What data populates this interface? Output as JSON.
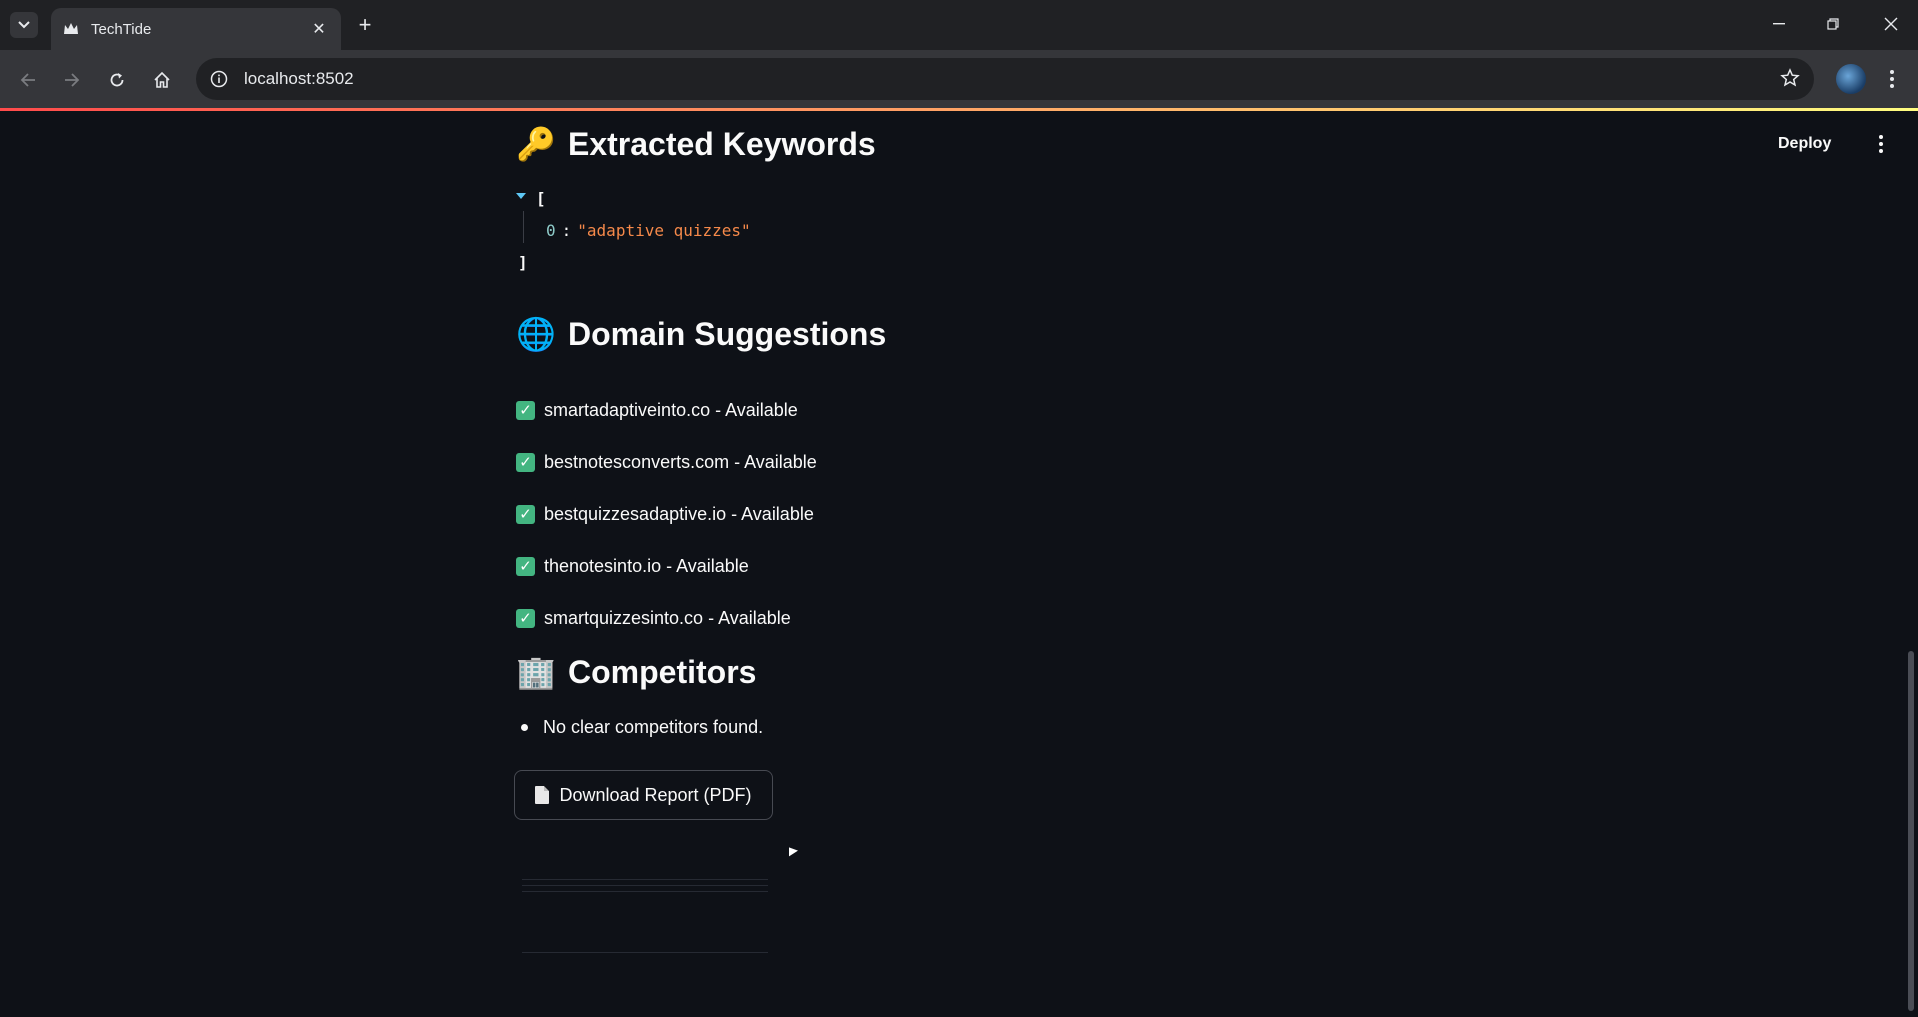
{
  "browser": {
    "tab_title": "TechTide",
    "url": "localhost:8502",
    "new_tab_symbol": "+",
    "close_symbol": "✕"
  },
  "app": {
    "deploy_label": "Deploy",
    "accent_colors": [
      "#ff4b4b",
      "#fffd80"
    ]
  },
  "keywords": {
    "emoji": "🔑",
    "heading": "Extracted Keywords",
    "open_bracket": "[",
    "close_bracket": "]",
    "items": [
      {
        "index": "0",
        "value": "\"adaptive quizzes\""
      }
    ]
  },
  "domains": {
    "emoji": "🌐",
    "heading": "Domain Suggestions",
    "check_symbol": "✓",
    "items": [
      "smartadaptiveinto.co - Available",
      "bestnotesconverts.com - Available",
      "bestquizzesadaptive.io - Available",
      "thenotesinto.io - Available",
      "smartquizzesinto.co - Available"
    ]
  },
  "competitors": {
    "emoji": "🏢",
    "heading": "Competitors",
    "items": [
      "No clear competitors found."
    ]
  },
  "download": {
    "label": "Download Report (PDF)"
  },
  "icons": {
    "tab_favicon": "crown-icon",
    "back": "arrow-left-icon",
    "forward": "arrow-right-icon",
    "reload": "reload-icon",
    "home": "home-icon",
    "site_info": "info-icon",
    "bookmark": "star-icon"
  }
}
